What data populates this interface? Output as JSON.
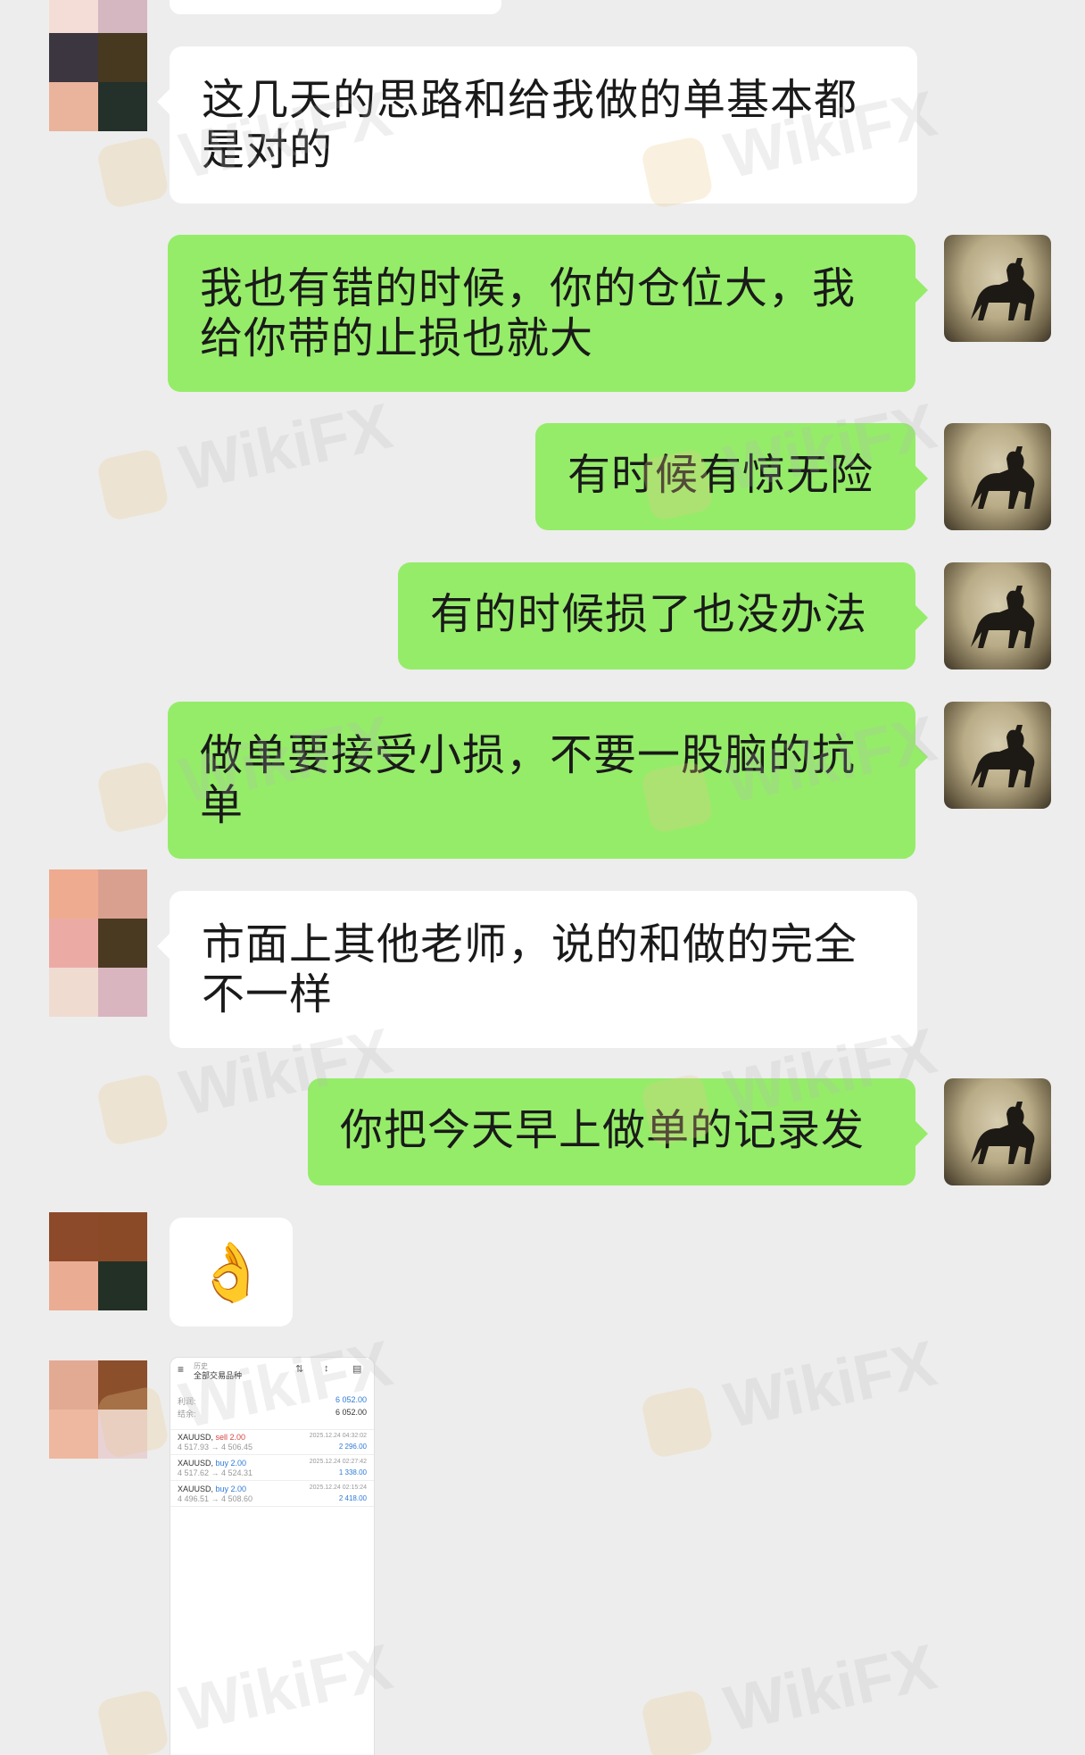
{
  "messages": [
    {
      "side": "left",
      "text_lines": [
        "这几天的思路和给我做的单基本都",
        "是对的"
      ]
    },
    {
      "side": "right",
      "text_lines": [
        "我也有错的时候，你的仓位大，我",
        "给你带的止损也就大"
      ]
    },
    {
      "side": "right",
      "text_lines": [
        "有时候有惊无险"
      ]
    },
    {
      "side": "right",
      "text_lines": [
        "有的时候损了也没办法"
      ]
    },
    {
      "side": "right",
      "text_lines": [
        "做单要接受小损，不要一股脑的抗",
        "单"
      ]
    },
    {
      "side": "left",
      "text_lines": [
        "市面上其他老师，说的和做的完全",
        "不一样"
      ]
    },
    {
      "side": "right",
      "text_lines": [
        "你把今天早上做单的记录发"
      ]
    },
    {
      "side": "left",
      "emoji": "👌"
    }
  ],
  "watermark": {
    "text": "WikiFX"
  },
  "trade_screenshot": {
    "header_small": "历史",
    "header_title": "全部交易品种",
    "summary": [
      {
        "label": "利润:",
        "value": "6 052.00"
      },
      {
        "label": "结余:",
        "value": "6 052.00"
      }
    ],
    "trades": [
      {
        "symbol": "XAUUSD,",
        "side": "sell 2.00",
        "prices": "4 517.93 → 4 506.45",
        "time": "2025.12.24 04:32:02",
        "profit": "2 296.00"
      },
      {
        "symbol": "XAUUSD,",
        "side": "buy 2.00",
        "prices": "4 517.62 → 4 524.31",
        "time": "2025.12.24 02:27:42",
        "profit": "1 338.00"
      },
      {
        "symbol": "XAUUSD,",
        "side": "buy 2.00",
        "prices": "4 496.51 → 4 508.60",
        "time": "2025.12.24 02:15:24",
        "profit": "2 418.00"
      }
    ]
  },
  "colors": {
    "background": "#ededed",
    "sent_bubble": "#95ec69",
    "received_bubble": "#ffffff"
  }
}
